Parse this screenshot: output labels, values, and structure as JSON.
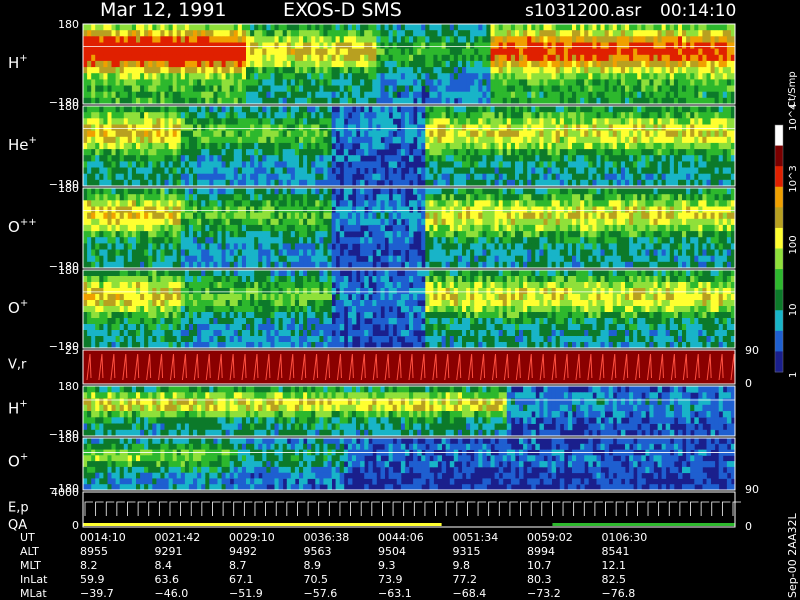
{
  "header": {
    "date": "Mar 12, 1991",
    "instrument": "EXOS-D SMS",
    "file": "s1031200.asr",
    "time": "00:14:10"
  },
  "footer": {
    "sidebar": "Sep-00  2AA32L"
  },
  "chart_data": {
    "type": "heatmap",
    "title": "Mar 12, 1991   EXOS-D SMS",
    "colorbar": {
      "label": "Ct/Smp",
      "scale": "log",
      "ticks": [
        "1",
        "10",
        "100",
        "10^3",
        "10^4"
      ],
      "tick_values": [
        1,
        10,
        100,
        1000,
        10000
      ],
      "colors": [
        "#1a1f8c",
        "#1e5fd0",
        "#18b4c8",
        "#0c7a2a",
        "#2db82d",
        "#8fe03a",
        "#ffff30",
        "#b8a020",
        "#f0a000",
        "#e02000",
        "#7a0000",
        "#ffffff"
      ]
    },
    "x_axis": {
      "labels": [
        "UT",
        "ALT",
        "MLT",
        "InLat",
        "MLat"
      ],
      "rows": [
        [
          "0014:10",
          "0021:42",
          "0029:10",
          "0036:38",
          "0044:06",
          "0051:34",
          "0059:02",
          "0106:30"
        ],
        [
          "8955",
          "9291",
          "9492",
          "9563",
          "9504",
          "9315",
          "8994",
          "8541"
        ],
        [
          "8.2",
          "8.4",
          "8.7",
          "8.9",
          "9.3",
          "9.8",
          "10.7",
          "12.1"
        ],
        [
          "59.9",
          "63.6",
          "67.1",
          "70.5",
          "73.9",
          "77.2",
          "80.3",
          "82.5"
        ],
        [
          "−39.7",
          "−46.0",
          "−51.9",
          "−57.6",
          "−63.1",
          "−68.4",
          "−73.2",
          "−76.8"
        ]
      ]
    },
    "panels": [
      {
        "name": "H",
        "sup": "+",
        "ymax": "180",
        "ymin": "−180",
        "kind": "spectro"
      },
      {
        "name": "He",
        "sup": "+",
        "ymax": "180",
        "ymin": "−180",
        "kind": "spectro"
      },
      {
        "name": "O",
        "sup": "++",
        "ymax": "180",
        "ymin": "−180",
        "kind": "spectro"
      },
      {
        "name": "O",
        "sup": "+",
        "ymax": "180",
        "ymin": "−180",
        "kind": "spectro"
      },
      {
        "name": "V,r",
        "sup": "",
        "ymax": "25",
        "ymin": "",
        "kind": "velocity",
        "right_top": "90",
        "right_bottom": "0"
      },
      {
        "name": "H",
        "sup": "+",
        "ymax": "180",
        "ymin": "−180",
        "kind": "spectro"
      },
      {
        "name": "O",
        "sup": "+",
        "ymax": "180",
        "ymin": "−180",
        "kind": "spectro",
        "right_bottom": "90"
      },
      {
        "name": "E,p",
        "name2": "QA",
        "sup": "",
        "ymax": "4000",
        "ymin": "0",
        "kind": "energy",
        "right_bottom": "0"
      }
    ]
  }
}
